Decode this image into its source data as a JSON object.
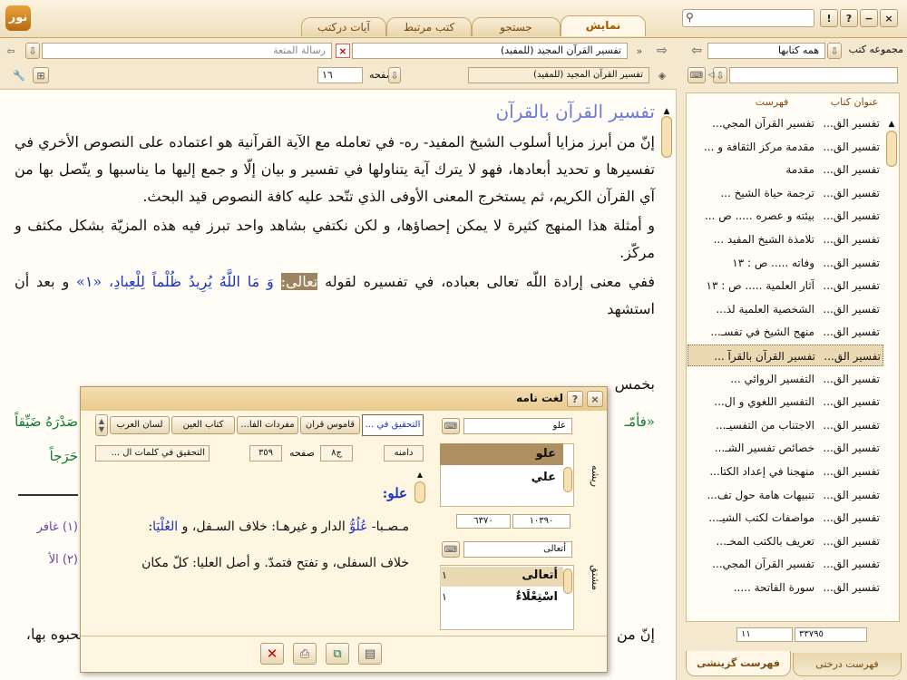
{
  "logo_text": "نور",
  "window_controls": [
    "!",
    "?",
    "−",
    "×"
  ],
  "tabs": [
    {
      "label": "نمايش",
      "active": true
    },
    {
      "label": "جستجو"
    },
    {
      "label": "كتب مرتبط"
    },
    {
      "label": "آيات درکتب"
    }
  ],
  "nav": {
    "book_title": "تفسير القرآن المجيد (للمفيد)",
    "other_title": "رسالة المتعة",
    "section_field": "تفسير القرآن المجيد (للمفيد)",
    "page_label": "صفحه",
    "page_value": "١٦"
  },
  "right_panel": {
    "collection_label": "مجموعه كتب",
    "collection_value": "همه كتابها",
    "col_book": "عنوان كتاب",
    "col_index": "فهرست",
    "rows": [
      {
        "book": "تفسير الق...",
        "index": "تفسير القرآن المجي..."
      },
      {
        "book": "تفسير الق...",
        "index": "مقدمة مركز الثقافة و ..."
      },
      {
        "book": "تفسير الق...",
        "index": "مقدمة"
      },
      {
        "book": "تفسير الق...",
        "index": "ترجمة حياة الشيخ ..."
      },
      {
        "book": "تفسير الق...",
        "index": "بيئته و عصره ..... ص ..."
      },
      {
        "book": "تفسير الق...",
        "index": "تلامذة الشيخ المفيد ..."
      },
      {
        "book": "تفسير الق...",
        "index": "وفاته ..... ص : ١٣"
      },
      {
        "book": "تفسير الق...",
        "index": "آثار العلمية ..... ص : ١٣"
      },
      {
        "book": "تفسير الق...",
        "index": "الشخصية العلمية لذ..."
      },
      {
        "book": "تفسير الق...",
        "index": "منهج الشيخ في تفسـ..."
      },
      {
        "book": "تفسير الق...",
        "index": "تفسير القرآن بالقرآ ...",
        "selected": true
      },
      {
        "book": "تفسير الق...",
        "index": "التفسير الروائي ..."
      },
      {
        "book": "تفسير الق...",
        "index": "التفسير اللغوي و ال..."
      },
      {
        "book": "تفسير الق...",
        "index": "الاجتناب من التفسيـ..."
      },
      {
        "book": "تفسير الق...",
        "index": "خصائص تفسير الشـ..."
      },
      {
        "book": "تفسير الق...",
        "index": "منهجنا في إعداد الكتا..."
      },
      {
        "book": "تفسير الق...",
        "index": "تنبيهات هامة حول تف..."
      },
      {
        "book": "تفسير الق...",
        "index": "مواصفات لكتب الشيـ..."
      },
      {
        "book": "تفسير الق...",
        "index": "تعريف بالكتب المخـ..."
      },
      {
        "book": "تفسير الق...",
        "index": "تفسير القرآن المجي..."
      },
      {
        "book": "تفسير الق...",
        "index": "سورة الفاتحة ....."
      }
    ],
    "count": "٣٣٧٩٥",
    "page": "١١",
    "bottom_tab_tree": "فهرست درختى",
    "bottom_tab_select": "فهرست گزينشى"
  },
  "content": {
    "heading": "تفسير القرآن بالقرآن",
    "p1": "إنّ من أبرز مزايا أسلوب الشيخ المفيد- ره- في تعامله مع الآية القرآنية هو اعتماده على النصوص الأخري في تفسيرها و تحديد أبعادها، فهو لا يترك آية يتناولها في تفسير و بيان إلّا و جمع إليها ما يناسبها و يتّصل بها من آي القرآن الكريم، ثم يستخرج المعنى الأوفى الذي تتّحد عليه كافة النصوص قيد البحث.",
    "p2": "و أمثلة هذا المنهج كثيرة لا يمكن إحصاؤها، و لكن نكتفي بشاهد واحد تبرز فيه هذه المزيّة بشكل مكثف و مركّز.",
    "p3a": "ففي معنى إرادة اللّه تعالى بعباده، في تفسيره لقوله ",
    "p3_highlight": "تعالى:",
    "p3_quran": " وَ مَا اللَّهُ يُرِيدُ ظُلْماً لِلْعِبادِ،",
    "p3_ref": " «١» ",
    "p3b": "و بعد أن استشهد",
    "p4": "بخمس",
    "p5_start": "«فأمّـ",
    "p5_end": "صَدْرَهُ ضَيِّقاً",
    "p6": "حَرَجاً",
    "fn1": "(١) غافر",
    "fn2": "(٢) الأ",
    "last_a": "إنّ من",
    "last_b": "يحبوه بها،"
  },
  "dialog": {
    "title": "لغت نامه",
    "tabs": [
      "التحقيق في ...",
      "قاموس قران",
      "مفردات الفا...",
      "كتاب العين",
      "لسان العرب"
    ],
    "root_label": "دامنه",
    "vol": "ج٨",
    "page_label": "صفحه",
    "page_value": "٣٥٩",
    "book_name": "التحقيق في كلمات ال ...",
    "side_root": "ريشه",
    "side_derived": "مشتق",
    "root_search": "علو",
    "root_list": [
      {
        "text": "علو",
        "selected": true
      },
      {
        "text": "علي"
      }
    ],
    "range_a": "١٠٣٩٠",
    "range_b": "٦٣٧٠",
    "derived_search": "أتعالى",
    "derived_list": [
      {
        "text": "أتعالى",
        "count": "١",
        "selected": true
      },
      {
        "text": "اسْتِعْلَاءٌ",
        "count": "١"
      }
    ],
    "entry_head": "علو:",
    "entry_l1a": "مـصـبا- ",
    "entry_l1_em": "عُلُوُّ",
    "entry_l1b": " الدار و غيرهـا: خلاف السـفل، و ",
    "entry_l1_em2": "العُلْيَا",
    "entry_l1c": ":",
    "entry_l2": "خلاف السفلى، و تفتح فتمدّ. و أصل العليا: كلّ مكان"
  }
}
